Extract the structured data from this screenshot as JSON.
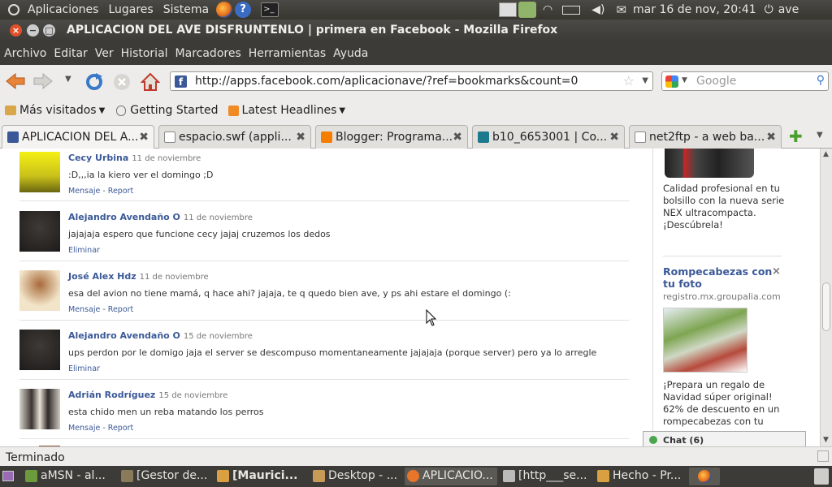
{
  "panel": {
    "menus": [
      "Aplicaciones",
      "Lugares",
      "Sistema"
    ],
    "clock": "mar 16 de nov, 20:41",
    "user": "ave"
  },
  "window": {
    "title": "APLICACION DEL AVE DISFRUNTENLO | primera en Facebook - Mozilla Firefox"
  },
  "menubar": [
    "Archivo",
    "Editar",
    "Ver",
    "Historial",
    "Marcadores",
    "Herramientas",
    "Ayuda"
  ],
  "nav": {
    "url": "http://apps.facebook.com/aplicacionave/?ref=bookmarks&count=0",
    "search_placeholder": "Google"
  },
  "bookmarks": [
    "Más visitados",
    "Getting Started",
    "Latest Headlines"
  ],
  "tabs": [
    {
      "label": "APLICACION DEL A...",
      "icon_color": "#3b5998"
    },
    {
      "label": "espacio.swf (appli...",
      "icon_color": "#ffffff"
    },
    {
      "label": "Blogger: Programa...",
      "icon_color": "#f57d00"
    },
    {
      "label": "b10_6653001 | Co...",
      "icon_color": "#1c7a8c"
    },
    {
      "label": "net2ftp - a web ba...",
      "icon_color": "#ffffff"
    }
  ],
  "comments": [
    {
      "name": "Cecy Urbina",
      "date": "11 de noviembre",
      "text": ":D,,,ia la kiero ver el domingo ;D",
      "actions": "Mensaje - Report"
    },
    {
      "name": "Alejandro Avendaño O",
      "date": "11 de noviembre",
      "text": "jajajaja espero que funcione cecy jajaj cruzemos los dedos",
      "actions": "Eliminar"
    },
    {
      "name": "José Alex Hdz",
      "date": "11 de noviembre",
      "text": "esa del avion no tiene mamá, q hace ahi? jajaja, te q quedo bien ave, y ps ahi estare el domingo (:",
      "actions": "Mensaje - Report"
    },
    {
      "name": "Alejandro Avendaño O",
      "date": "15 de noviembre",
      "text": "ups perdon por le domigo jaja el server se descompuso momentaneamente jajajaja (porque server) pero ya lo arregle",
      "actions": "Eliminar"
    },
    {
      "name": "Adrián Rodríguez",
      "date": "15 de noviembre",
      "text": "esta chido men un reba matando los perros",
      "actions": "Mensaje - Report"
    }
  ],
  "ads": {
    "ad1": {
      "text": "Calidad profesional en tu bolsillo con la nueva serie NEX ultracompacta. ¡Descúbrela!"
    },
    "ad2": {
      "title": "Rompecabezas con tu foto",
      "domain": "registro.mx.groupalia.com",
      "text": "¡Prepara un regalo de Navidad súper original! 62% de descuento en un rompecabezas con tu"
    }
  },
  "chat": {
    "label": "Chat (6)"
  },
  "status": "Terminado",
  "taskbar": [
    {
      "label": "aMSN - al...",
      "icon": "#6c9a3c"
    },
    {
      "label": "[Gestor de...",
      "icon": "#8a7a5a"
    },
    {
      "label": "[Maurici...",
      "icon": "#d8a040"
    },
    {
      "label": "Desktop - ...",
      "icon": "#c79a58"
    },
    {
      "label": "APLICACIO...",
      "icon": "#e8752a"
    },
    {
      "label": "[http___se...",
      "icon": "#bbbbbb"
    },
    {
      "label": "Hecho - Pr...",
      "icon": "#d8a040"
    }
  ]
}
